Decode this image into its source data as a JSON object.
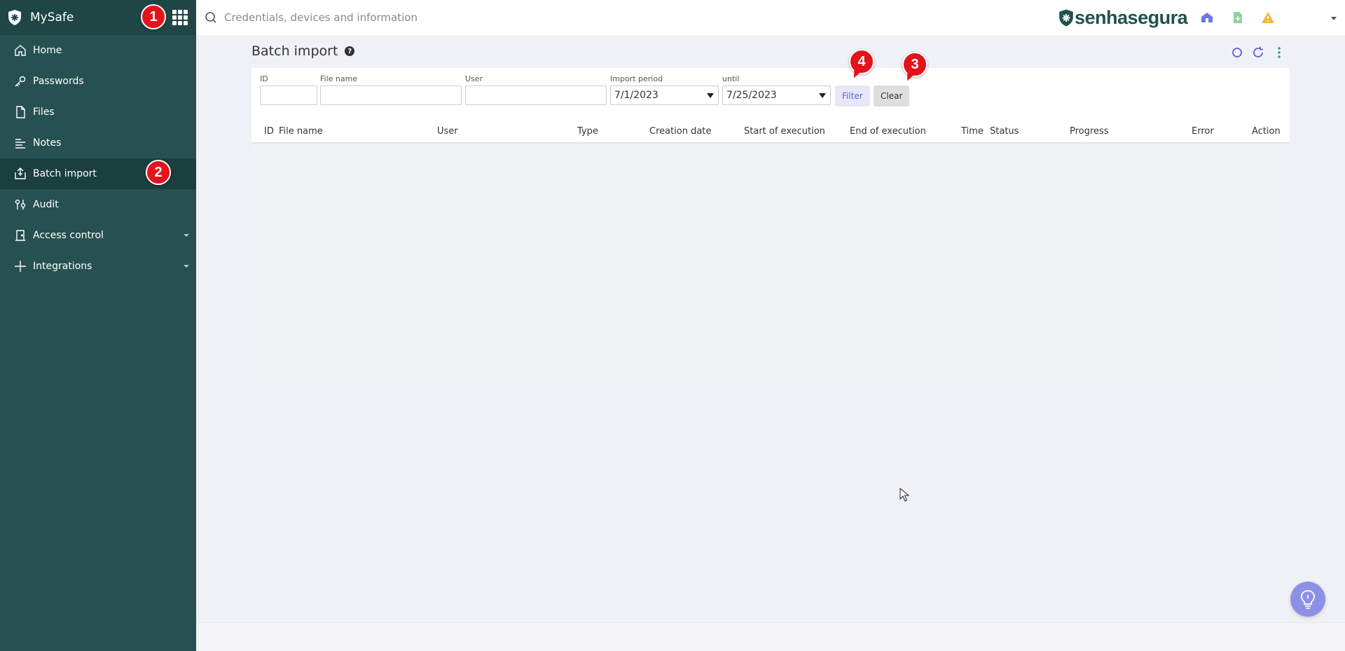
{
  "app": {
    "title": "MySafe"
  },
  "sidebar": {
    "items": [
      {
        "label": "Home",
        "icon": "home-icon",
        "active": false,
        "expandable": false
      },
      {
        "label": "Passwords",
        "icon": "key-icon",
        "active": false,
        "expandable": false
      },
      {
        "label": "Files",
        "icon": "file-icon",
        "active": false,
        "expandable": false
      },
      {
        "label": "Notes",
        "icon": "notes-icon",
        "active": false,
        "expandable": false
      },
      {
        "label": "Batch import",
        "icon": "upload-icon",
        "active": true,
        "expandable": false
      },
      {
        "label": "Audit",
        "icon": "audit-icon",
        "active": false,
        "expandable": false
      },
      {
        "label": "Access control",
        "icon": "door-icon",
        "active": false,
        "expandable": true
      },
      {
        "label": "Integrations",
        "icon": "plus-icon",
        "active": false,
        "expandable": true
      }
    ]
  },
  "topbar": {
    "search_placeholder": "Credentials, devices and information",
    "brand_part1": "senha",
    "brand_part2": "segura"
  },
  "page": {
    "title": "Batch import"
  },
  "filters": {
    "id_label": "ID",
    "file_label": "File name",
    "user_label": "User",
    "period_label": "Import period",
    "until_label": "until",
    "period_value": "7/1/2023",
    "until_value": "7/25/2023",
    "filter_label": "Filter",
    "clear_label": "Clear"
  },
  "table": {
    "columns": [
      "ID",
      "File name",
      "User",
      "Type",
      "Creation date",
      "Start of execution",
      "End of execution",
      "Time",
      "Status",
      "Progress",
      "Error",
      "Action"
    ],
    "rows": []
  },
  "markers": [
    "1",
    "2",
    "3",
    "4"
  ],
  "colors": {
    "sidebar": "#265150",
    "accent": "#5b64d6",
    "marker": "#e3131b"
  }
}
